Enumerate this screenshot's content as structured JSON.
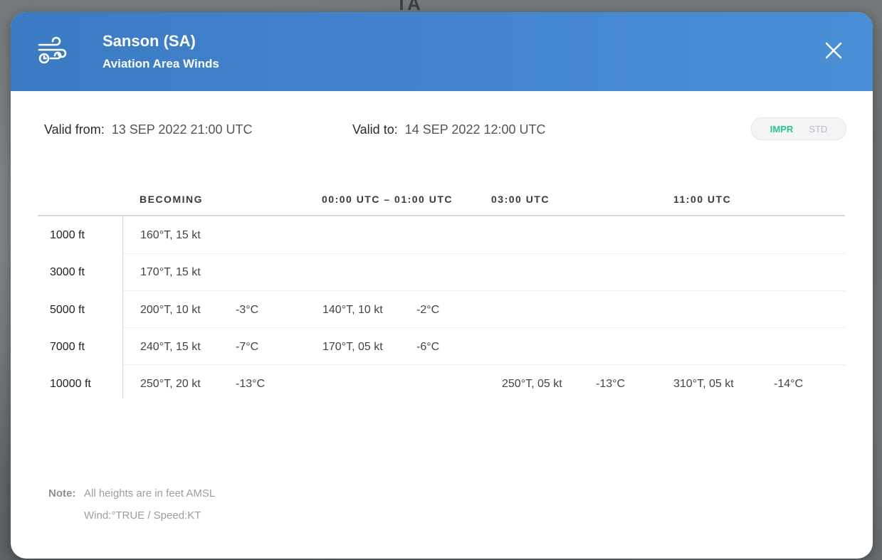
{
  "backdrop": {
    "map_label": "TA"
  },
  "header": {
    "title": "Sanson (SA)",
    "subtitle": "Aviation Area Winds",
    "icon": "wind-clock-icon",
    "close_icon": "close-icon",
    "color": "#4a8fd6"
  },
  "validity": {
    "from_label": "Valid from:",
    "from_value": "13 SEP 2022 21:00 UTC",
    "to_label": "Valid to:",
    "to_value": "14 SEP 2022 12:00 UTC"
  },
  "units_toggle": {
    "active": "IMPR",
    "inactive": "STD",
    "active_color": "#2bc48a"
  },
  "table": {
    "headers": [
      "BECOMING",
      "00:00 UTC – 01:00 UTC",
      "03:00 UTC",
      "11:00 UTC"
    ],
    "rows": [
      {
        "altitude": "1000 ft",
        "cells": [
          {
            "wind": "160°T, 15 kt",
            "temp": ""
          },
          null,
          null,
          null
        ]
      },
      {
        "altitude": "3000 ft",
        "cells": [
          {
            "wind": "170°T, 15 kt",
            "temp": ""
          },
          null,
          null,
          null
        ]
      },
      {
        "altitude": "5000 ft",
        "cells": [
          {
            "wind": "200°T, 10 kt",
            "temp": "-3°C"
          },
          {
            "wind": "140°T, 10 kt",
            "temp": "-2°C"
          },
          null,
          null
        ]
      },
      {
        "altitude": "7000 ft",
        "cells": [
          {
            "wind": "240°T, 15 kt",
            "temp": "-7°C"
          },
          {
            "wind": "170°T, 05 kt",
            "temp": "-6°C"
          },
          null,
          null
        ]
      },
      {
        "altitude": "10000 ft",
        "cells": [
          {
            "wind": "250°T, 20 kt",
            "temp": "-13°C"
          },
          null,
          {
            "wind": "250°T, 05 kt",
            "temp": "-13°C"
          },
          {
            "wind": "310°T, 05 kt",
            "temp": "-14°C"
          }
        ]
      }
    ]
  },
  "note": {
    "label": "Note:",
    "line1": "All heights are in feet AMSL",
    "line2": "Wind:°TRUE / Speed:KT"
  }
}
